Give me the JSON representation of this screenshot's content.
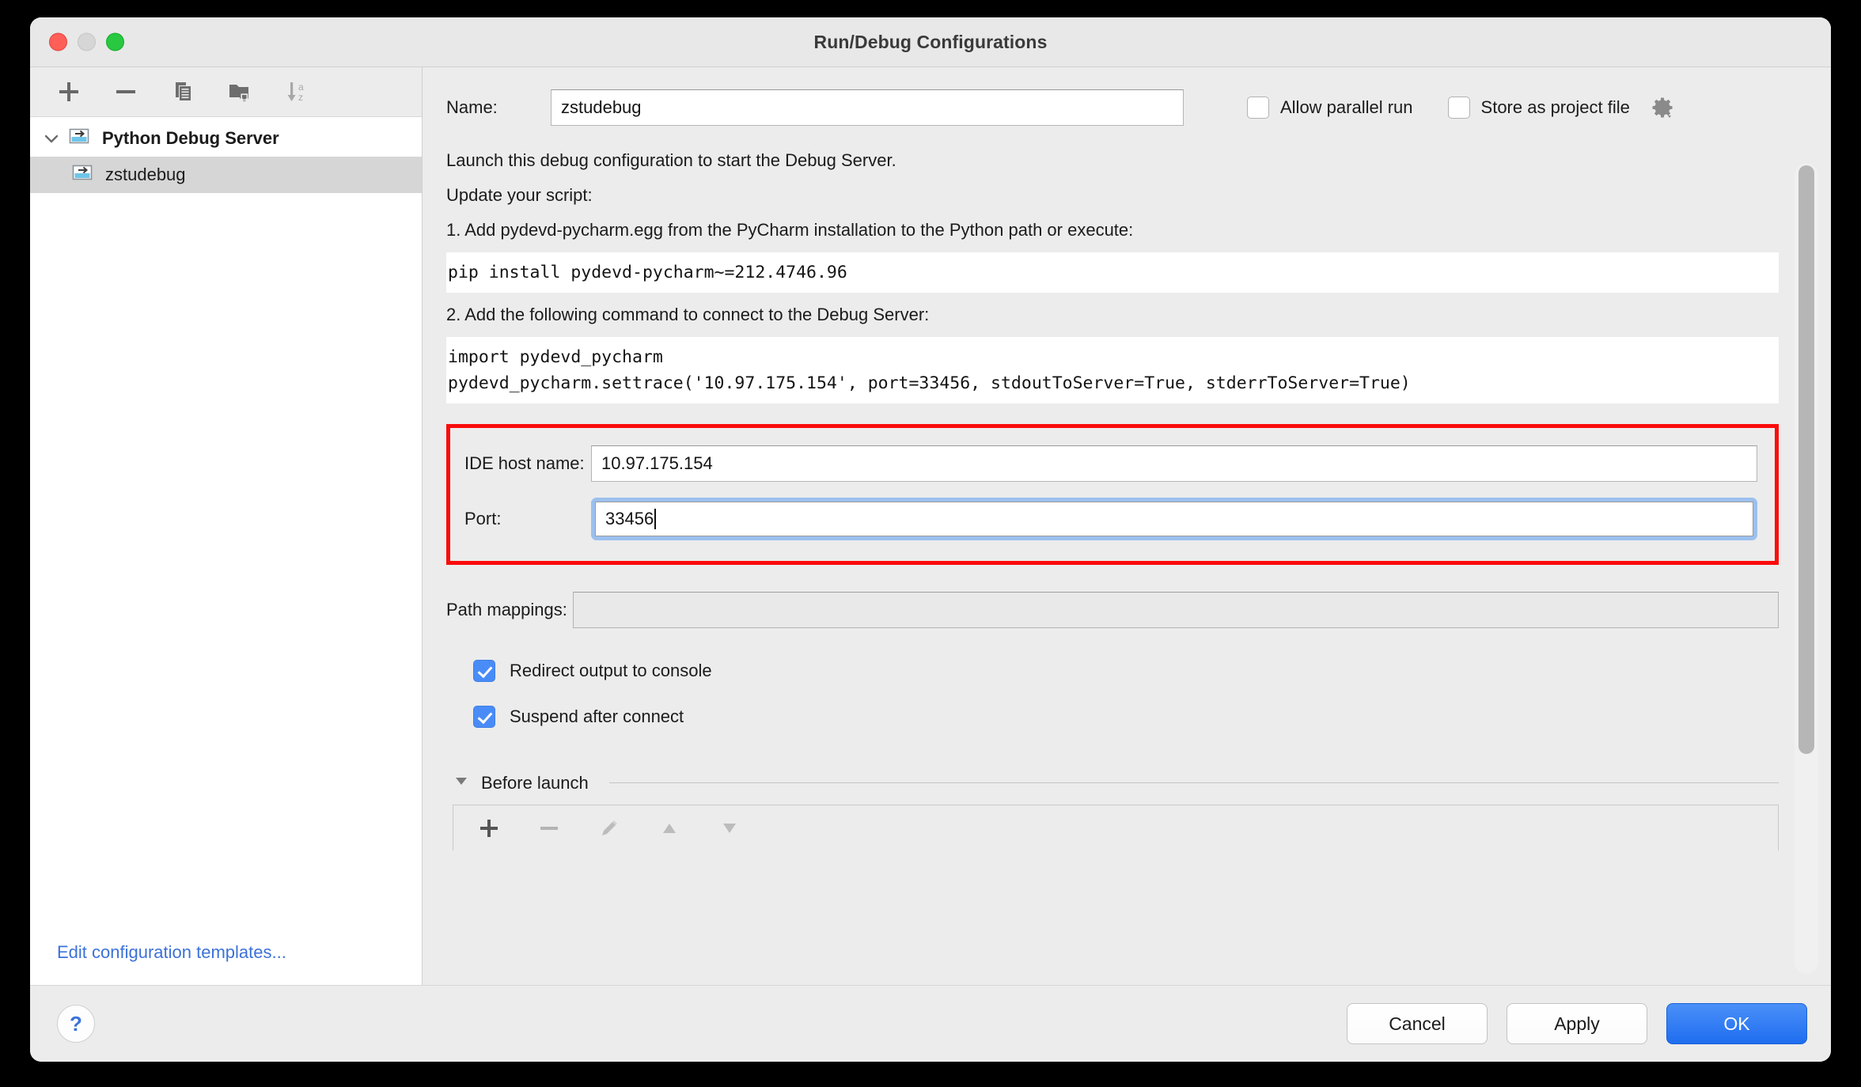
{
  "window": {
    "title": "Run/Debug Configurations",
    "traffic_lights": [
      "close",
      "minimize",
      "zoom"
    ]
  },
  "left_panel": {
    "toolbar": [
      {
        "name": "add-configuration-button",
        "icon": "plus-icon"
      },
      {
        "name": "remove-configuration-button",
        "icon": "minus-icon"
      },
      {
        "name": "copy-configuration-button",
        "icon": "copy-icon"
      },
      {
        "name": "new-folder-button",
        "icon": "new-folder-icon"
      },
      {
        "name": "sort-alphabetically-button",
        "icon": "sort-az-icon"
      }
    ],
    "tree": [
      {
        "label": "Python Debug Server",
        "level": 0,
        "selected": false,
        "expanded": true,
        "icon": "python-debug-server-icon"
      },
      {
        "label": "zstudebug",
        "level": 1,
        "selected": true,
        "icon": "python-debug-server-icon"
      }
    ],
    "edit_templates_link": "Edit configuration templates..."
  },
  "form": {
    "name_label": "Name:",
    "name_value": "zstudebug",
    "name_placeholder": "",
    "allow_parallel_run": {
      "label": "Allow parallel run",
      "checked": false
    },
    "store_as_project_file": {
      "label": "Store as project file",
      "checked": false
    },
    "gear_icon": "gear-icon",
    "info_lines": [
      "Launch this debug configuration to start the Debug Server.",
      "Update your script:",
      "1. Add pydevd-pycharm.egg from the PyCharm installation to the Python path or execute:"
    ],
    "code_block_1": "pip install pydevd-pycharm~=212.4746.96",
    "info_line_2": "2. Add the following command to connect to the Debug Server:",
    "code_block_2_line_1": "import pydevd_pycharm",
    "code_block_2_line_2": "pydevd_pycharm.settrace('10.97.175.154', port=33456, stdoutToServer=True, stderrToServer=True)",
    "ide_host_name": {
      "label": "IDE host name:",
      "value": "10.97.175.154",
      "focused": false
    },
    "port": {
      "label": "Port:",
      "value": "33456",
      "focused": true
    },
    "path_mappings": {
      "label": "Path mappings:",
      "value": "",
      "browse_icon": "folder-open-icon"
    },
    "redirect_output": {
      "label": "Redirect output to console",
      "checked": true
    },
    "suspend_after_connect": {
      "label": "Suspend after connect",
      "checked": true
    },
    "before_launch": {
      "title": "Before launch",
      "expanded": true,
      "toolbar": [
        {
          "name": "before-launch-add-button",
          "icon": "plus-icon",
          "enabled": true
        },
        {
          "name": "before-launch-remove-button",
          "icon": "minus-icon",
          "enabled": false
        },
        {
          "name": "before-launch-edit-button",
          "icon": "pencil-icon",
          "enabled": false
        },
        {
          "name": "before-launch-move-up-button",
          "icon": "triangle-up-icon",
          "enabled": false
        },
        {
          "name": "before-launch-move-down-button",
          "icon": "triangle-down-icon",
          "enabled": false
        }
      ]
    }
  },
  "footer": {
    "help_label": "?",
    "cancel_label": "Cancel",
    "apply_label": "Apply",
    "ok_label": "OK"
  },
  "colors": {
    "accent_blue": "#1f6df0",
    "checkbox_blue": "#4a8cf7",
    "highlight_red": "#fb0b0b",
    "link_blue": "#3c72d8",
    "focus_ring_blue": "#9cc0ef"
  }
}
